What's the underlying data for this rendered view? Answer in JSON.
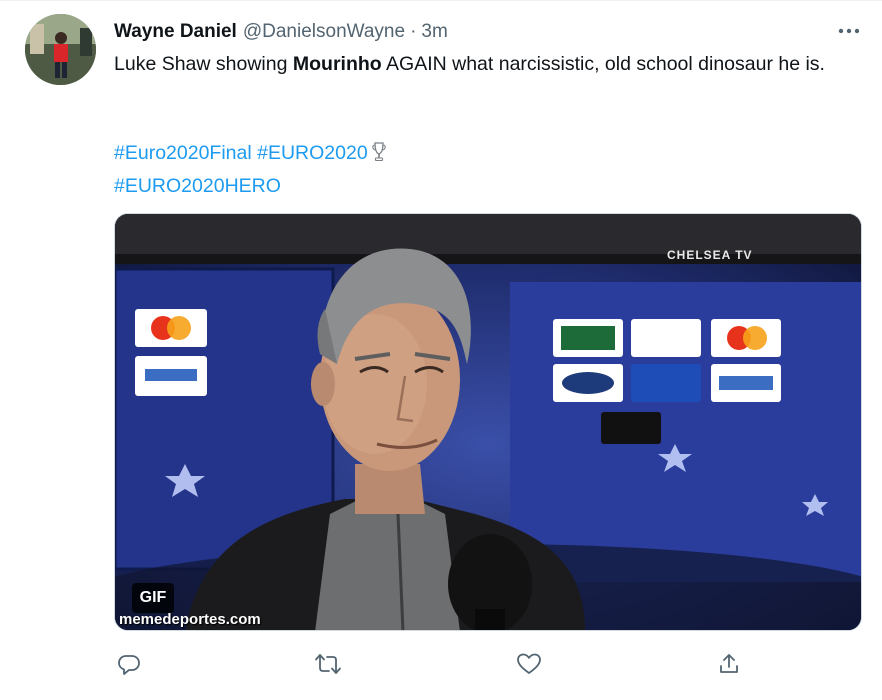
{
  "tweet": {
    "author_name": "Wayne Daniel",
    "handle": "@DanielsonWayne",
    "separator": "·",
    "time": "3m",
    "text_before": "Luke Shaw showing ",
    "text_bold": "Mourinho",
    "text_after": " AGAIN what narcissistic, old school dinosaur he is.",
    "hashtags": [
      "#Euro2020Final",
      "#EURO2020",
      "#EURO2020HERO"
    ]
  },
  "media": {
    "badge": "GIF",
    "watermark": "memedeportes.com",
    "overlay_text": "CHELSEA TV"
  },
  "icons": {
    "more": "more-horizontal-icon",
    "reply": "reply-icon",
    "retweet": "retweet-icon",
    "like": "like-icon",
    "share": "share-icon",
    "trophy": "trophy-icon"
  },
  "colors": {
    "link": "#1d9bf0",
    "secondary_text": "#536471",
    "primary_text": "#0f1419"
  }
}
